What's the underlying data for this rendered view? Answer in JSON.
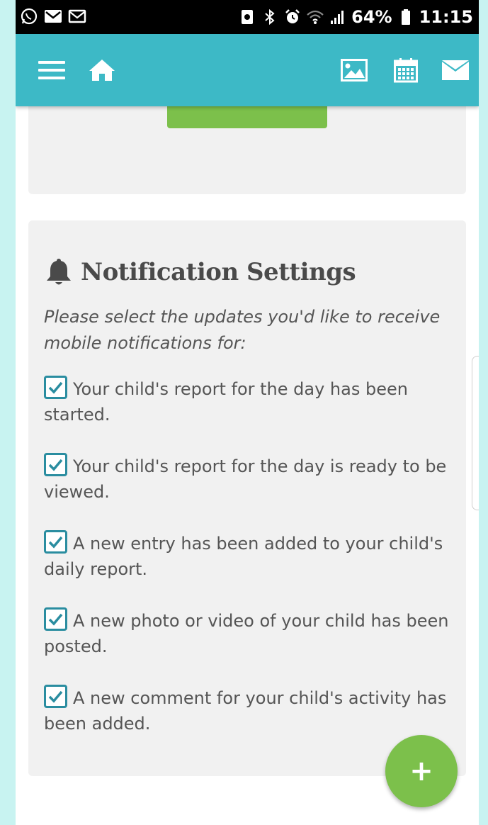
{
  "status_bar": {
    "left_icons": [
      "whatsapp-icon",
      "gmail-icon",
      "mail-icon"
    ],
    "right_icons": [
      "storage-icon",
      "bluetooth-icon",
      "alarm-icon",
      "wifi-icon",
      "signal-icon"
    ],
    "battery": "64%",
    "time": "11:15"
  },
  "app_bar": {
    "color": "#3db9c6",
    "left_icons": [
      "menu-icon",
      "home-icon"
    ],
    "right_icons": [
      "photo-icon",
      "calendar-icon",
      "envelope-icon"
    ]
  },
  "top_card": {
    "button_color": "#7cc04b"
  },
  "notifications": {
    "title": "Notification Settings",
    "description": "Please select the updates you'd like to receive mobile notifications for:",
    "options": [
      {
        "label": "Your child's report for the day has been started.",
        "checked": true
      },
      {
        "label": "Your child's report for the day is ready to be viewed.",
        "checked": true
      },
      {
        "label": "A new entry has been added to your child's daily report.",
        "checked": true
      },
      {
        "label": "A new photo or video of your child has been posted.",
        "checked": true
      },
      {
        "label": "A new comment for your child's activity has been added.",
        "checked": true
      }
    ]
  },
  "fab": {
    "label": "+",
    "color": "#7cc04b"
  }
}
